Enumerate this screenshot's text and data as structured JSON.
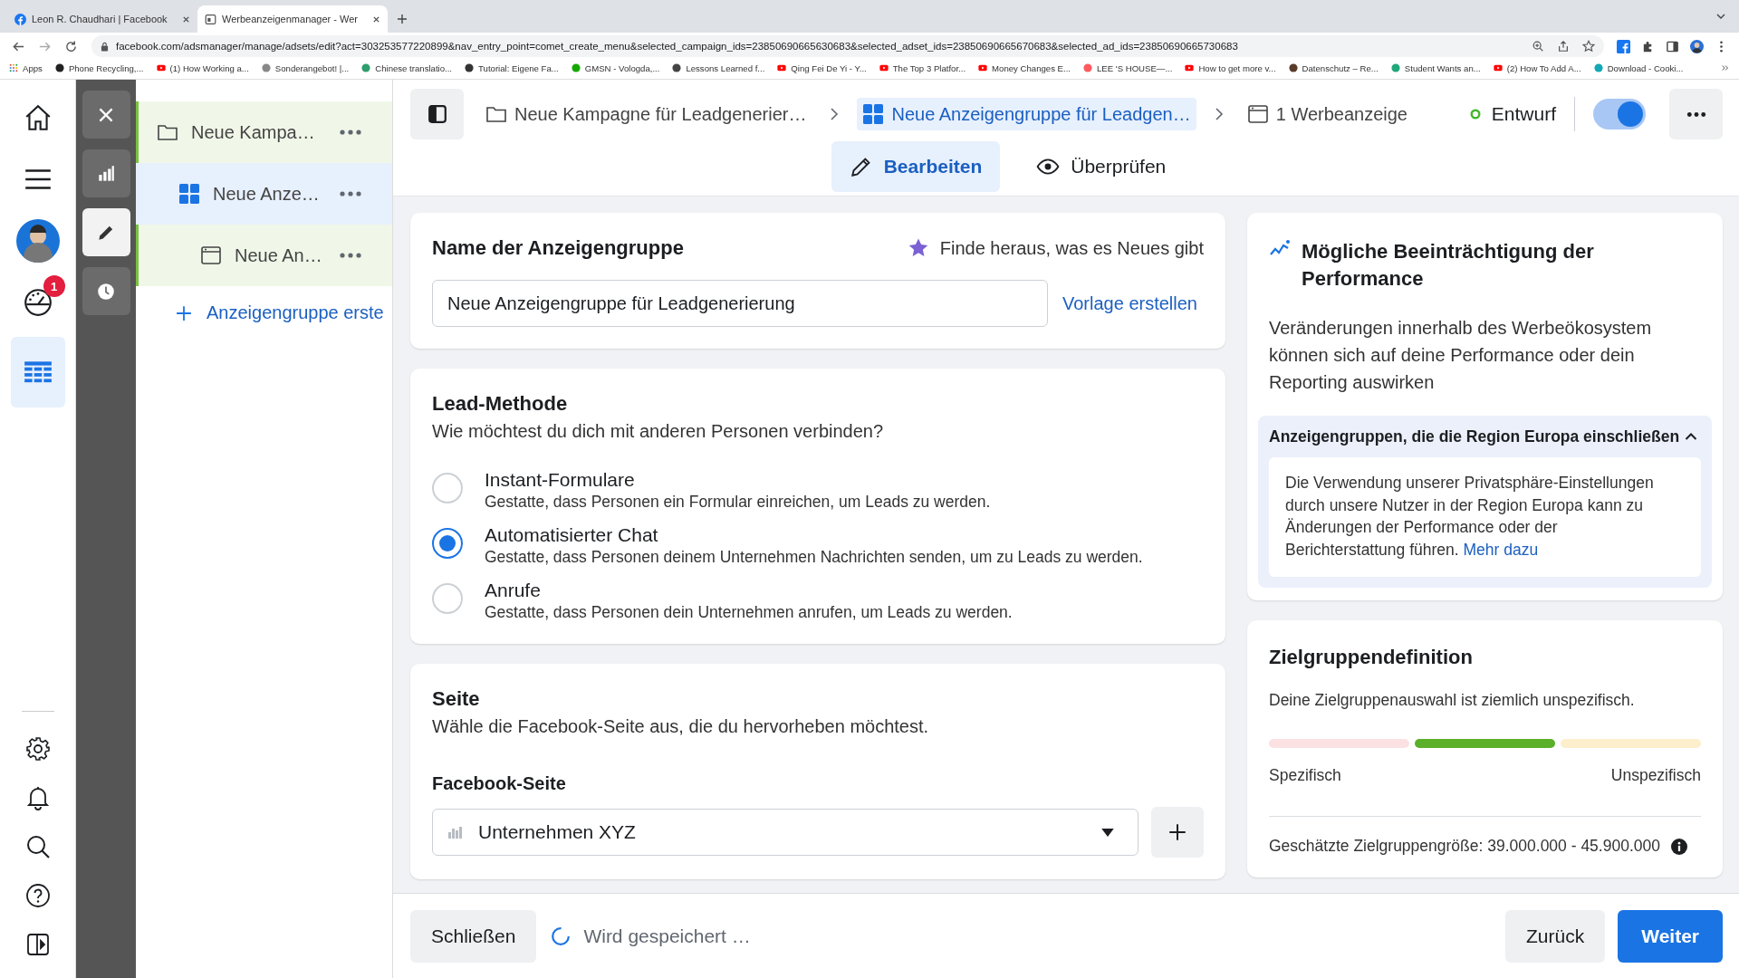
{
  "browser": {
    "tabs": [
      {
        "title": "Leon R. Chaudhari | Facebook",
        "selected": false
      },
      {
        "title": "Werbeanzeigenmanager - Wer",
        "selected": true
      }
    ],
    "url": "facebook.com/adsmanager/manage/adsets/edit?act=303253577220899&nav_entry_point=comet_create_menu&selected_campaign_ids=23850690665630683&selected_adset_ids=23850690665670683&selected_ad_ids=23850690665730683",
    "bookmarks": [
      {
        "label": "Apps",
        "kind": "apps"
      },
      {
        "label": "Phone Recycling,...",
        "kind": "site",
        "color": "#222222"
      },
      {
        "label": "(1) How Working a...",
        "kind": "video"
      },
      {
        "label": "Sonderangebot! |...",
        "kind": "site",
        "color": "#888888"
      },
      {
        "label": "Chinese translatio...",
        "kind": "site",
        "color": "#2e9e6a"
      },
      {
        "label": "Tutorial: Eigene Fa...",
        "kind": "site",
        "color": "#333333"
      },
      {
        "label": "GMSN - Vologda,...",
        "kind": "site",
        "color": "#14a800"
      },
      {
        "label": "Lessons Learned f...",
        "kind": "site",
        "color": "#444444"
      },
      {
        "label": "Qing Fei De Yi - Y...",
        "kind": "video"
      },
      {
        "label": "The Top 3 Platfor...",
        "kind": "video"
      },
      {
        "label": "Money Changes E...",
        "kind": "video"
      },
      {
        "label": "LEE 'S HOUSE—...",
        "kind": "site",
        "color": "#ff5a5f"
      },
      {
        "label": "How to get more v...",
        "kind": "video"
      },
      {
        "label": "Datenschutz – Re...",
        "kind": "site",
        "color": "#5a3a2a"
      },
      {
        "label": "Student Wants an...",
        "kind": "site",
        "color": "#1fa87a"
      },
      {
        "label": "(2) How To Add A...",
        "kind": "video"
      },
      {
        "label": "Download - Cooki...",
        "kind": "site",
        "color": "#13a8b5"
      }
    ]
  },
  "nav": {
    "top": [
      {
        "kind": "home",
        "selected": false
      },
      {
        "kind": "menu",
        "selected": false
      },
      {
        "kind": "avatar",
        "selected": false
      },
      {
        "kind": "gauge",
        "selected": false,
        "badge": "1"
      },
      {
        "kind": "table",
        "selected": true
      }
    ],
    "bottom": [
      {
        "kind": "settings"
      },
      {
        "kind": "bell"
      },
      {
        "kind": "search"
      },
      {
        "kind": "help"
      },
      {
        "kind": "panel"
      }
    ]
  },
  "tools": [
    {
      "kind": "close",
      "selected": false
    },
    {
      "kind": "chart",
      "selected": false
    },
    {
      "kind": "edit",
      "selected": true
    },
    {
      "kind": "history",
      "selected": false
    }
  ],
  "tree": {
    "items": [
      {
        "kind": "campaign",
        "label": "Neue Kampa…",
        "selected": false,
        "children": [
          {
            "kind": "adset",
            "label": "Neue Anze…",
            "selected": true,
            "children": [
              {
                "kind": "ad",
                "label": "Neue An…",
                "selected": false
              }
            ]
          }
        ]
      }
    ],
    "create_label": "Anzeigengruppe erste"
  },
  "header": {
    "breadcrumbs": [
      {
        "kind": "campaign",
        "label": "Neue Kampagne für Leadgenerier…",
        "selected": false
      },
      {
        "kind": "adset",
        "label": "Neue Anzeigengruppe für Leadgen…",
        "selected": true
      },
      {
        "kind": "ad",
        "label": "1 Werbeanzeige",
        "selected": false
      }
    ],
    "status": "Entwurf",
    "toggle_on": true,
    "mode_tabs": [
      {
        "kind": "edit",
        "label": "Bearbeiten",
        "selected": true
      },
      {
        "kind": "review",
        "label": "Überprüfen",
        "selected": false
      }
    ]
  },
  "name_card": {
    "title": "Name der Anzeigengruppe",
    "whats_new": "Finde heraus, was es Neues gibt",
    "value": "Neue Anzeigengruppe für Leadgenerierung",
    "template_link": "Vorlage erstellen"
  },
  "lead_card": {
    "title": "Lead-Methode",
    "subtitle": "Wie möchtest du dich mit anderen Personen verbinden?",
    "options": [
      {
        "label": "Instant-Formulare",
        "description": "Gestatte, dass Personen ein Formular einreichen, um Leads zu werden.",
        "selected": false
      },
      {
        "label": "Automatisierter Chat",
        "description": "Gestatte, dass Personen deinem Unternehmen Nachrichten senden, um zu Leads zu werden.",
        "selected": true
      },
      {
        "label": "Anrufe",
        "description": "Gestatte, dass Personen dein Unternehmen anrufen, um Leads zu werden.",
        "selected": false
      }
    ]
  },
  "page_card": {
    "title": "Seite",
    "subtitle": "Wähle die Facebook-Seite aus, die du hervorheben möchtest.",
    "field_label": "Facebook-Seite",
    "value": "Unternehmen XYZ"
  },
  "impact_card": {
    "title": "Mögliche Beeinträchtigung der Performance",
    "body": "Veränderungen innerhalb des Werbeökosystem können sich auf deine Performance oder dein Reporting auswirken",
    "accordion": {
      "title": "Anzeigengruppen, die die Region Europa einschließen",
      "expanded": true,
      "text": "Die Verwendung unserer Privatsphäre-Einstellungen durch unsere Nutzer in der Region Europa kann zu Änderungen der Performance oder der Berichterstattung führen.",
      "link": "Mehr dazu"
    }
  },
  "audience_card": {
    "title": "Zielgruppendefinition",
    "text": "Deine Zielgruppenauswahl ist ziemlich unspezifisch.",
    "segments": [
      {
        "color": "#fbe1e2"
      },
      {
        "color": "#5bb02a"
      },
      {
        "color": "#fdefcb"
      }
    ],
    "low_label": "Spezifisch",
    "high_label": "Unspezifisch",
    "size": "Geschätzte Zielgruppengröße: 39.000.000 - 45.900.000"
  },
  "footer": {
    "close": "Schließen",
    "saving": "Wird gespeichert …",
    "back": "Zurück",
    "next": "Weiter"
  }
}
